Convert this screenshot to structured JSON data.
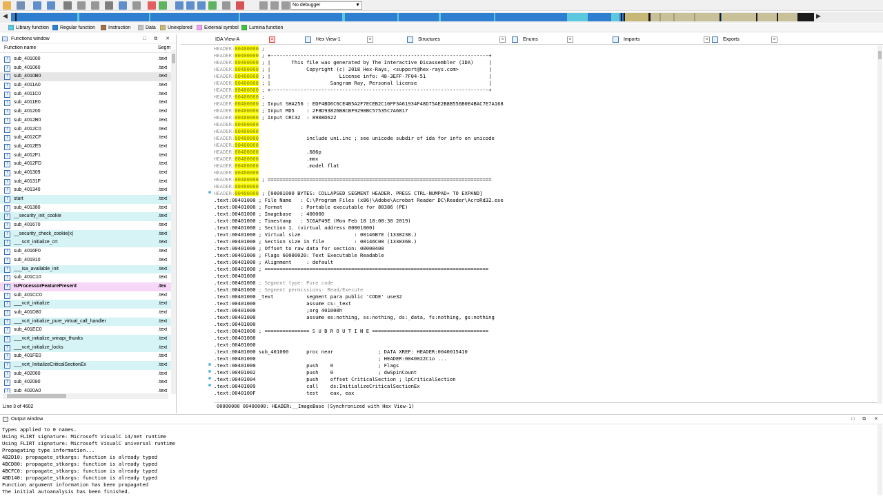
{
  "toolbar": {
    "debugger_label": "No debugger",
    "buttons": [
      {
        "icon": "open-folder-icon",
        "color": "#e8a020"
      },
      {
        "icon": "save-icon",
        "color": "#4a6fa5"
      },
      {
        "icon": "back-arrow-icon",
        "color": "#2d6fc0"
      },
      {
        "icon": "forward-arrow-icon",
        "color": "#2d6fc0"
      },
      {
        "icon": "search-icon",
        "color": "#5a5a5a"
      },
      {
        "icon": "hex-icon",
        "color": "#7a7a7a"
      },
      {
        "icon": "bookmark-icon",
        "color": "#7a7a7a"
      },
      {
        "icon": "jump-icon",
        "color": "#5a5a5a"
      },
      {
        "icon": "download-icon",
        "color": "#2d6fc0"
      },
      {
        "icon": "patch-icon",
        "color": "#7a7a7a"
      },
      {
        "icon": "warning-icon",
        "color": "#e03030"
      },
      {
        "icon": "run-green-icon",
        "color": "#30a030"
      },
      {
        "icon": "graph-icon",
        "color": "#2d6fc0"
      },
      {
        "icon": "graph2-icon",
        "color": "#2d6fc0"
      },
      {
        "icon": "flow-icon",
        "color": "#2d6fc0"
      },
      {
        "icon": "struct-icon",
        "color": "#30a030"
      },
      {
        "icon": "plugin-icon",
        "color": "#7a7a7a"
      },
      {
        "icon": "stop-red-icon",
        "color": "#d02020"
      },
      {
        "icon": "play-icon",
        "color": "#808080"
      },
      {
        "icon": "pause-icon",
        "color": "#808080"
      },
      {
        "icon": "stop-icon",
        "color": "#808080"
      }
    ]
  },
  "legend": [
    {
      "label": "Library function",
      "color": "#5bc8e0"
    },
    {
      "label": "Regular function",
      "color": "#2f7fd0"
    },
    {
      "label": "Instruction",
      "color": "#a0704a"
    },
    {
      "label": "Data",
      "color": "#c0c0c0"
    },
    {
      "label": "Unexplored",
      "color": "#c8b878"
    },
    {
      "label": "External symbol",
      "color": "#f0a0f0"
    },
    {
      "label": "Lumina function",
      "color": "#40c040"
    }
  ],
  "functions_window": {
    "title": "Functions window",
    "col_name": "Function name",
    "col_seg": "Segm",
    "status": "Line 3 of 4602",
    "rows": [
      {
        "name": "sub_401000",
        "seg": ".text",
        "type": "normal"
      },
      {
        "name": "sub_401060",
        "seg": ".text",
        "type": "normal"
      },
      {
        "name": "sub_4010B0",
        "seg": ".text",
        "type": "sel"
      },
      {
        "name": "sub_4011A0",
        "seg": ".text",
        "type": "normal"
      },
      {
        "name": "sub_4011C0",
        "seg": ".text",
        "type": "normal"
      },
      {
        "name": "sub_4011E0",
        "seg": ".text",
        "type": "normal"
      },
      {
        "name": "sub_401200",
        "seg": ".text",
        "type": "normal"
      },
      {
        "name": "sub_4012B0",
        "seg": ".text",
        "type": "normal"
      },
      {
        "name": "sub_4012C0",
        "seg": ".text",
        "type": "normal"
      },
      {
        "name": "sub_4012CF",
        "seg": ".text",
        "type": "normal"
      },
      {
        "name": "sub_4012E5",
        "seg": ".text",
        "type": "normal"
      },
      {
        "name": "sub_4012F1",
        "seg": ".text",
        "type": "normal"
      },
      {
        "name": "sub_4012FD",
        "seg": ".text",
        "type": "normal"
      },
      {
        "name": "sub_401309",
        "seg": ".text",
        "type": "normal"
      },
      {
        "name": "sub_40131F",
        "seg": ".text",
        "type": "normal"
      },
      {
        "name": "sub_401340",
        "seg": ".text",
        "type": "normal"
      },
      {
        "name": "start",
        "seg": ".text",
        "type": "lib"
      },
      {
        "name": "sub_401380",
        "seg": ".text",
        "type": "normal"
      },
      {
        "name": "__security_init_cookie",
        "seg": ".text",
        "type": "lib"
      },
      {
        "name": "sub_401670",
        "seg": ".text",
        "type": "normal"
      },
      {
        "name": "__security_check_cookie(x)",
        "seg": ".text",
        "type": "lib"
      },
      {
        "name": "___scrt_initialize_crt",
        "seg": ".text",
        "type": "lib"
      },
      {
        "name": "sub_4016F0",
        "seg": ".text",
        "type": "normal"
      },
      {
        "name": "sub_401910",
        "seg": ".text",
        "type": "normal"
      },
      {
        "name": "___isa_available_init",
        "seg": ".text",
        "type": "lib"
      },
      {
        "name": "sub_401C10",
        "seg": ".text",
        "type": "normal"
      },
      {
        "name": "IsProcessorFeaturePresent",
        "seg": ".tex",
        "type": "ext"
      },
      {
        "name": "sub_401CC0",
        "seg": ".text",
        "type": "normal"
      },
      {
        "name": "___vcrt_initialize",
        "seg": ".text",
        "type": "lib"
      },
      {
        "name": "sub_401D80",
        "seg": ".text",
        "type": "normal"
      },
      {
        "name": "___vcrt_initialize_pure_virtual_call_handler",
        "seg": ".text",
        "type": "lib"
      },
      {
        "name": "sub_401EC0",
        "seg": ".text",
        "type": "normal"
      },
      {
        "name": "___vcrt_initialize_winapi_thunks",
        "seg": ".text",
        "type": "lib"
      },
      {
        "name": "___vcrt_initialize_locks",
        "seg": ".text",
        "type": "lib"
      },
      {
        "name": "sub_401FE0",
        "seg": ".text",
        "type": "normal"
      },
      {
        "name": "___vcrt_InitializeCriticalSectionEx",
        "seg": ".text",
        "type": "lib"
      },
      {
        "name": "sub_402060",
        "seg": ".text",
        "type": "normal"
      },
      {
        "name": "sub_402080",
        "seg": ".text",
        "type": "normal"
      },
      {
        "name": "sub_4020A0",
        "seg": ".text",
        "type": "normal"
      }
    ]
  },
  "tabs": [
    {
      "label": "IDA View-A",
      "active": true
    },
    {
      "label": "Hex View-1",
      "active": false
    },
    {
      "label": "Structures",
      "active": false
    },
    {
      "label": "Enums",
      "active": false
    },
    {
      "label": "Imports",
      "active": false
    },
    {
      "label": "Exports",
      "active": false
    }
  ],
  "code": {
    "status": "00000000 00400000: HEADER:__ImageBase (Synchronized with Hex View-1)",
    "lines": [
      {
        "addr": "HEADER:",
        "hl": "00400000",
        "text": " ;",
        "hdr": true
      },
      {
        "addr": "HEADER:",
        "hl": "00400000",
        "text": " ; +-------------------------------------------------------------------------+",
        "hdr": true
      },
      {
        "addr": "HEADER:",
        "hl": "00400000",
        "text": " ; |       This file was generated by The Interactive Disassembler (IDA)     |",
        "hdr": true
      },
      {
        "addr": "HEADER:",
        "hl": "00400000",
        "text": " ; |            Copyright (c) 2018 Hex-Rays, <support@hex-rays.com>          |",
        "hdr": true
      },
      {
        "addr": "HEADER:",
        "hl": "00400000",
        "text": " ; |                       License info: 48-3EFF-7F04-51                     |",
        "hdr": true
      },
      {
        "addr": "HEADER:",
        "hl": "00400000",
        "text": " ; |                    Sangram Ray, Personal license                        |",
        "hdr": true
      },
      {
        "addr": "HEADER:",
        "hl": "00400000",
        "text": " ; +-------------------------------------------------------------------------+",
        "hdr": true
      },
      {
        "addr": "HEADER:",
        "hl": "00400000",
        "text": " ;",
        "hdr": true
      },
      {
        "addr": "HEADER:",
        "hl": "00400000",
        "text": " ; Input SHA256 : EDF4BD6C6CE4B5A2F7ECEB2C10FF3A61934F48D75AE2B8B556B0E4BAC7E7A168",
        "hdr": true
      },
      {
        "addr": "HEADER:",
        "hl": "00400000",
        "text": " ; Input MD5    : 2F8D93826B8CBF9290BC57535C7A6817",
        "hdr": true
      },
      {
        "addr": "HEADER:",
        "hl": "00400000",
        "text": " ; Input CRC32  : 8908D622",
        "hdr": true
      },
      {
        "addr": "HEADER:",
        "hl": "00400000",
        "text": "",
        "hdr": true
      },
      {
        "addr": "HEADER:",
        "hl": "00400000",
        "text": "",
        "hdr": true
      },
      {
        "addr": "HEADER:",
        "hl": "00400000",
        "text": "                include uni.inc ; see unicode subdir of ida for info on unicode",
        "hdr": true
      },
      {
        "addr": "HEADER:",
        "hl": "00400000",
        "text": "",
        "hdr": true
      },
      {
        "addr": "HEADER:",
        "hl": "00400000",
        "text": "                .686p",
        "hdr": true
      },
      {
        "addr": "HEADER:",
        "hl": "00400000",
        "text": "                .mmx",
        "hdr": true
      },
      {
        "addr": "HEADER:",
        "hl": "00400000",
        "text": "                .model flat",
        "hdr": true
      },
      {
        "addr": "HEADER:",
        "hl": "00400000",
        "text": "",
        "hdr": true
      },
      {
        "addr": "HEADER:",
        "hl": "00400000",
        "text": " ; ===========================================================================",
        "hdr": true
      },
      {
        "addr": "HEADER:",
        "hl": "00400000",
        "text": "",
        "hdr": true
      },
      {
        "addr": "HEADER:",
        "hl": "00400000",
        "text": " ; [00001000 BYTES: COLLAPSED SEGMENT HEADER. PRESS CTRL-NUMPAD+ TO EXPAND]",
        "hdr": true
      },
      {
        "addr": ".text:00401000",
        "hl": "",
        "text": " ; File Name   : C:\\Program Files (x86)\\Adobe\\Acrobat Reader DC\\Reader\\AcroRd32.exe",
        "hdr": false
      },
      {
        "addr": ".text:00401000",
        "hl": "",
        "text": " ; Format      : Portable executable for 80386 (PE)",
        "hdr": false
      },
      {
        "addr": ".text:00401000",
        "hl": "",
        "text": " ; Imagebase   : 400000",
        "hdr": false
      },
      {
        "addr": ".text:00401000",
        "hl": "",
        "text": " ; Timestamp   : 5C6AF49E (Mon Feb 18 18:08:30 2019)",
        "hdr": false
      },
      {
        "addr": ".text:00401000",
        "hl": "",
        "text": " ; Section 1. (virtual address 00001000)",
        "hdr": false
      },
      {
        "addr": ".text:00401000",
        "hl": "",
        "text": " ; Virtual size                  : 00146B7E (1338238.)",
        "hdr": false
      },
      {
        "addr": ".text:00401000",
        "hl": "",
        "text": " ; Section size in file          : 00146C00 (1338368.)",
        "hdr": false
      },
      {
        "addr": ".text:00401000",
        "hl": "",
        "text": " ; Offset to raw data for section: 00000400",
        "hdr": false
      },
      {
        "addr": ".text:00401000",
        "hl": "",
        "text": " ; Flags 60000020: Text Executable Readable",
        "hdr": false
      },
      {
        "addr": ".text:00401000",
        "hl": "",
        "text": " ; Alignment     : default",
        "hdr": false
      },
      {
        "addr": ".text:00401000",
        "hl": "",
        "text": " ; ===========================================================================",
        "hdr": false
      },
      {
        "addr": ".text:00401000",
        "hl": "",
        "text": "",
        "hdr": false
      },
      {
        "addr": ".text:00401000",
        "hl": "",
        "text": " ; Segment type: Pure code",
        "hdr": false,
        "cmt": true
      },
      {
        "addr": ".text:00401000",
        "hl": "",
        "text": " ; Segment permissions: Read/Execute",
        "hdr": false,
        "cmt": true
      },
      {
        "addr": ".text:00401000",
        "hl": "",
        "text": " _text           segment para public 'CODE' use32",
        "hdr": false
      },
      {
        "addr": ".text:00401000",
        "hl": "",
        "text": "                 assume cs:_text",
        "hdr": false
      },
      {
        "addr": ".text:00401000",
        "hl": "",
        "text": "                 ;org 401000h",
        "hdr": false
      },
      {
        "addr": ".text:00401000",
        "hl": "",
        "text": "                 assume es:nothing, ss:nothing, ds:_data, fs:nothing, gs:nothing",
        "hdr": false
      },
      {
        "addr": ".text:00401000",
        "hl": "",
        "text": "",
        "hdr": false
      },
      {
        "addr": ".text:00401000",
        "hl": "",
        "text": " ; =============== S U B R O U T I N E =======================================",
        "hdr": false
      },
      {
        "addr": ".text:00401000",
        "hl": "",
        "text": "",
        "hdr": false
      },
      {
        "addr": ".text:00401000",
        "hl": "",
        "text": "",
        "hdr": false
      },
      {
        "addr": ".text:00401000",
        "hl": "",
        "text": " sub_401000      proc near               ; DATA XREF: HEADER:0040015410",
        "hdr": false
      },
      {
        "addr": ".text:00401000",
        "hl": "",
        "text": "                                         ; HEADER:0040022C1o ...",
        "hdr": false
      },
      {
        "addr": ".text:00401000",
        "hl": "",
        "text": "                 push    0               ; Flags",
        "hdr": false
      },
      {
        "addr": ".text:00401002",
        "hl": "",
        "text": "                 push    0               ; dwSpinCount",
        "hdr": false
      },
      {
        "addr": ".text:00401004",
        "hl": "",
        "text": "                 push    offset CriticalSection ; lpCriticalSection",
        "hdr": false
      },
      {
        "addr": ".text:00401009",
        "hl": "",
        "text": "                 call    ds:InitializeCriticalSectionEx",
        "hdr": false
      },
      {
        "addr": ".text:0040100F",
        "hl": "",
        "text": "                 test    eax, eax",
        "hdr": false
      }
    ]
  },
  "output": {
    "title": "Output window",
    "lines": [
      "Types applied to 0 names.",
      "Using FLIRT signature: Microsoft VisualC 14/net runtime",
      "Using FLIRT signature: Microsoft VisualC universal runtime",
      "Propagating type information...",
      "4B2D10: propagate_stkargs: function is already typed",
      "4BCD80: propagate_stkargs: function is already typed",
      "4BCFC0: propagate_stkargs: function is already typed",
      "4BD140: propagate_stkargs: function is already typed",
      "Function argument information has been propagated",
      "The initial autoanalysis has been finished."
    ]
  }
}
